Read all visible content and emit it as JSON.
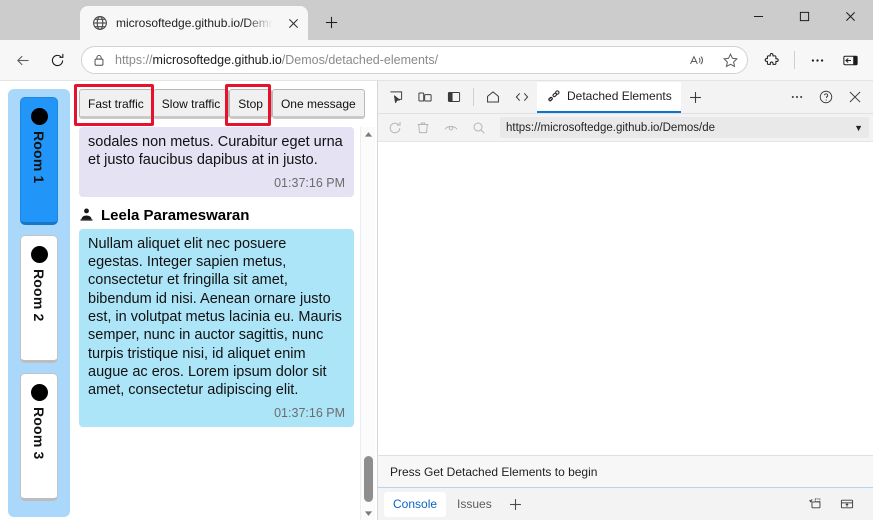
{
  "browser": {
    "tab": {
      "title": "microsoftedge.github.io/Demos/d",
      "favicon": "globe-icon",
      "close": "close-icon"
    },
    "new_tab_label": "+",
    "window_controls": {
      "minimize": "minimize-icon",
      "maximize": "maximize-icon",
      "close": "close-icon"
    },
    "nav": {
      "back": "back-arrow-icon",
      "refresh": "refresh-icon",
      "lock": "lock-icon",
      "url_scheme": "https://",
      "url_host": "microsoftedge.github.io",
      "url_path": "/Demos/detached-elements/",
      "read_aloud": "read-aloud-icon",
      "favorite": "star-icon",
      "extensions": "puzzle-piece-icon",
      "settings_more": "ellipsis-icon",
      "sidebar": "sidebar-toggle-icon"
    }
  },
  "page": {
    "rooms": [
      {
        "label": "Room 1",
        "active": true
      },
      {
        "label": "Room 2",
        "active": false
      },
      {
        "label": "Room 3",
        "active": false
      }
    ],
    "toolbar_buttons": [
      {
        "label": "Fast traffic",
        "highlighted": true
      },
      {
        "label": "Slow traffic",
        "highlighted": false
      },
      {
        "label": "Stop",
        "highlighted": true
      },
      {
        "label": "One message",
        "highlighted": false
      }
    ],
    "messages": [
      {
        "author": "",
        "text": "sodales non metus. Curabitur eget urna et justo faucibus dapibus at in justo.",
        "time": "01:37:16 PM",
        "color": "lavender"
      },
      {
        "author": "Leela Parameswaran",
        "text": "Nullam aliquet elit nec posuere egestas. Integer sapien metus, consectetur et fringilla sit amet, bibendum id nisi. Aenean ornare justo est, in volutpat metus lacinia eu. Mauris semper, nunc in auctor sagittis, nunc turpis tristique nisi, id aliquet enim augue ac eros. Lorem ipsum dolor sit amet, consectetur adipiscing elit.",
        "time": "01:37:16 PM",
        "color": "cyan"
      }
    ],
    "scrollbar": {
      "up": "scroll-up-arrow-icon",
      "down": "scroll-down-arrow-icon"
    }
  },
  "devtools": {
    "toolbar_icons": [
      "inspect-element-icon",
      "device-emulation-icon",
      "dock-side-icon",
      "home-icon",
      "code-brackets-icon"
    ],
    "active_tab": {
      "label": "Detached Elements",
      "icon": "detached-elements-icon"
    },
    "add_tab": "+",
    "more_tools": "ellipsis-icon",
    "help": "help-circle-icon",
    "close": "close-icon",
    "subtoolbar": {
      "refresh": "refresh-icon",
      "clear": "trash-icon",
      "detach": "eye-icon",
      "search": "search-icon",
      "url": "https://microsoftedge.github.io/Demos/de",
      "caret": "▼"
    },
    "status_message": "Press Get Detached Elements to begin",
    "drawer": {
      "tabs": [
        {
          "label": "Console",
          "active": true
        },
        {
          "label": "Issues",
          "active": false
        }
      ],
      "add": "+",
      "right_icons": [
        "console-settings-icon",
        "console-sidebar-icon"
      ]
    }
  },
  "colors": {
    "accent": "#0b76d0",
    "highlight": "#e8112d",
    "room_active": "#2196f8",
    "rooms_panel": "#a9d8fb",
    "bubble_lavender": "#e4e2f3",
    "bubble_cyan": "#ade5f8"
  }
}
